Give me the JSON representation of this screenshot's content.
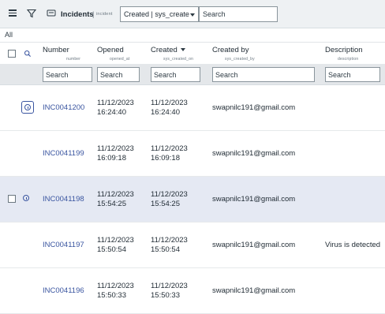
{
  "header": {
    "title": "Incidents",
    "table_name": "incident",
    "sort_select_value": "Created | sys_create",
    "search_placeholder": "Search"
  },
  "breadcrumb": "All",
  "columns": [
    {
      "label": "Number",
      "field": "number"
    },
    {
      "label": "Opened",
      "field": "opened_at"
    },
    {
      "label": "Created",
      "field": "sys_created_on"
    },
    {
      "label": "Created by",
      "field": "sys_created_by"
    },
    {
      "label": "Description",
      "field": "description"
    }
  ],
  "column_search_placeholder": "Search",
  "rows": [
    {
      "number": "INC0041200",
      "opened_date": "11/12/2023",
      "opened_time": "16:24:40",
      "created_date": "11/12/2023",
      "created_time": "16:24:40",
      "created_by": "swapnilc191@gmail.com",
      "description": ""
    },
    {
      "number": "INC0041199",
      "opened_date": "11/12/2023",
      "opened_time": "16:09:18",
      "created_date": "11/12/2023",
      "created_time": "16:09:18",
      "created_by": "swapnilc191@gmail.com",
      "description": ""
    },
    {
      "number": "INC0041198",
      "opened_date": "11/12/2023",
      "opened_time": "15:54:25",
      "created_date": "11/12/2023",
      "created_time": "15:54:25",
      "created_by": "swapnilc191@gmail.com",
      "description": ""
    },
    {
      "number": "INC0041197",
      "opened_date": "11/12/2023",
      "opened_time": "15:50:54",
      "created_date": "11/12/2023",
      "created_time": "15:50:54",
      "created_by": "swapnilc191@gmail.com",
      "description": "Virus is detected"
    },
    {
      "number": "INC0041196",
      "opened_date": "11/12/2023",
      "opened_time": "15:50:33",
      "created_date": "11/12/2023",
      "created_time": "15:50:33",
      "created_by": "swapnilc191@gmail.com",
      "description": ""
    }
  ]
}
